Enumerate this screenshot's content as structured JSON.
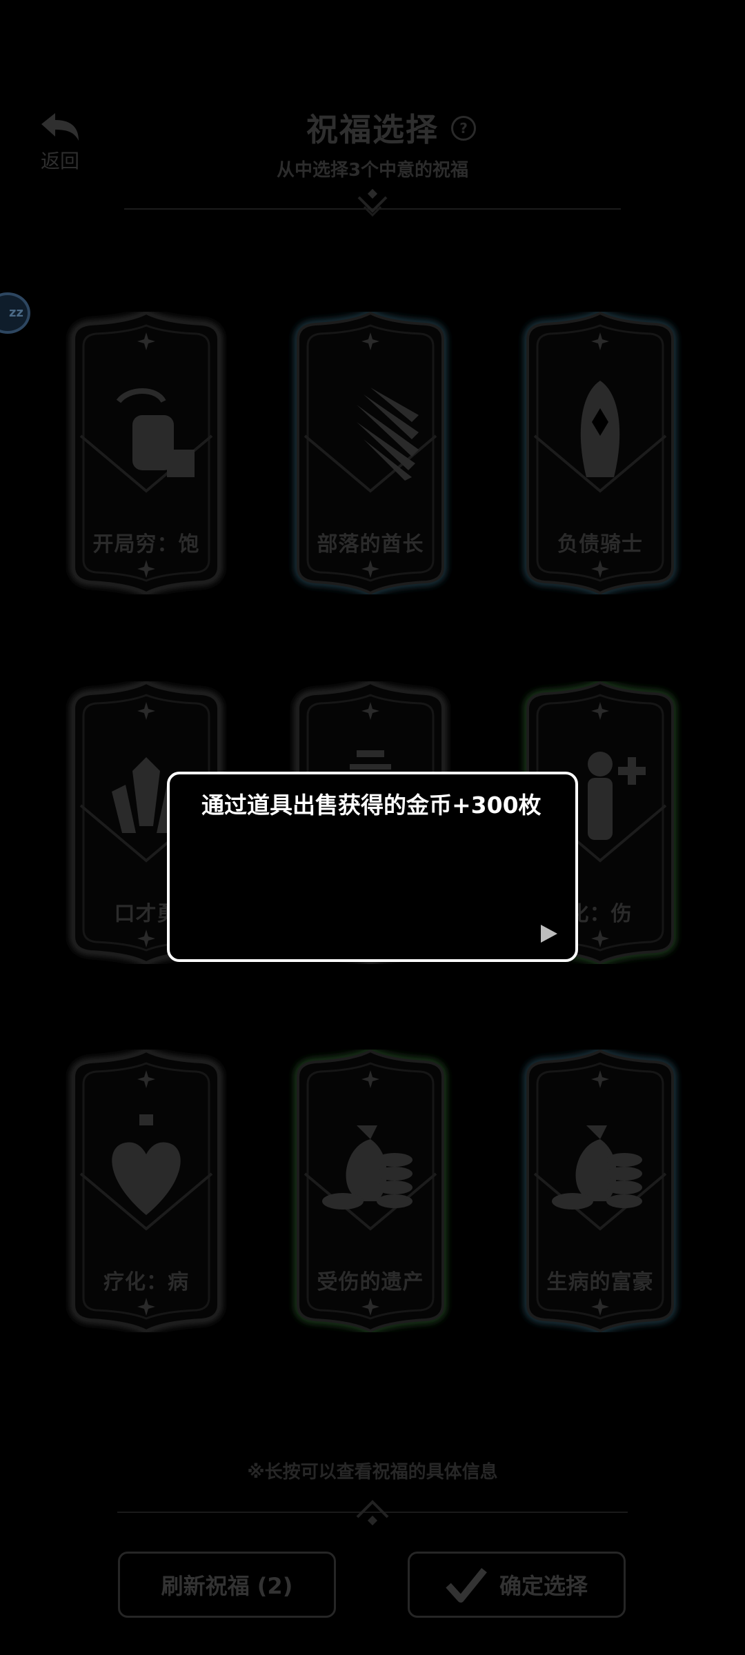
{
  "header": {
    "back_label": "返回",
    "title": "祝福选择",
    "help_glyph": "?",
    "subtitle": "从中选择3个中意的祝福"
  },
  "side_bubble": {
    "text": "zz"
  },
  "cards": [
    {
      "name": "开局穷：饱",
      "icon": "hand-coin-icon",
      "glow": "#2a2a2a"
    },
    {
      "name": "部落的酋长",
      "icon": "feather-headdress-icon",
      "glow": "#1f3a47"
    },
    {
      "name": "负债骑士",
      "icon": "knight-helmet-icon",
      "glow": "#1f3a47"
    },
    {
      "name": "口才勇",
      "icon": "crystal-icon",
      "glow": "#2a2a2a"
    },
    {
      "name": "",
      "icon": "potion-icon",
      "glow": "#2a2a2a"
    },
    {
      "name": "化：伤",
      "icon": "person-plus-icon",
      "glow": "#1f3f1f"
    },
    {
      "name": "疗化：病",
      "icon": "heart-potion-icon",
      "glow": "#2a2a2a"
    },
    {
      "name": "受伤的遗产",
      "icon": "money-bag-icon",
      "glow": "#1f3f1f"
    },
    {
      "name": "生病的富豪",
      "icon": "money-bag-icon",
      "glow": "#1f3a47"
    }
  ],
  "footer": {
    "hint": "※长按可以查看祝福的具体信息",
    "refresh_label": "刷新祝福 (2)",
    "confirm_label": "确定选择"
  },
  "dialog": {
    "text": "通过道具出售获得的金币+300枚",
    "next_icon": "play-triangle-icon"
  }
}
